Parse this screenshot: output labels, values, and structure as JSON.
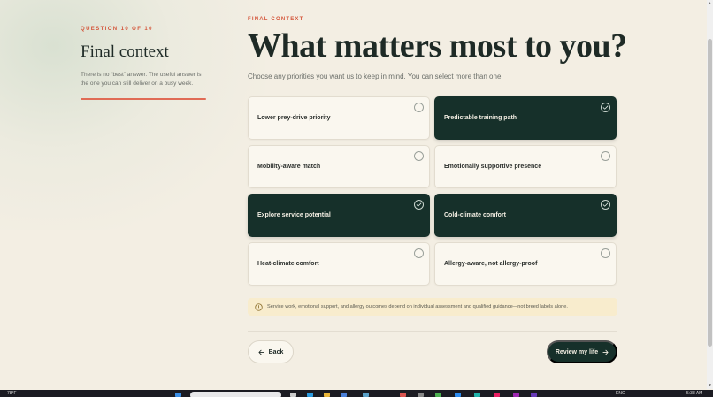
{
  "sidebar": {
    "eyebrow": "QUESTION 10 OF 10",
    "title": "Final context",
    "description": "There is no “best” answer. The useful answer is the one you can still deliver on a busy week.",
    "progress": 1.0
  },
  "main": {
    "eyebrow": "FINAL CONTEXT",
    "headline": "What matters most to you?",
    "subtitle": "Choose any priorities you want us to keep in mind. You can select more than one.",
    "options": [
      {
        "label": "Lower prey-drive priority",
        "selected": false
      },
      {
        "label": "Predictable training path",
        "selected": true
      },
      {
        "label": "Mobility-aware match",
        "selected": false
      },
      {
        "label": "Emotionally supportive presence",
        "selected": false
      },
      {
        "label": "Explore service potential",
        "selected": true
      },
      {
        "label": "Cold-climate comfort",
        "selected": true
      },
      {
        "label": "Heat-climate comfort",
        "selected": false
      },
      {
        "label": "Allergy-aware, not allergy-proof",
        "selected": false
      }
    ],
    "notice": "Service work, emotional support, and allergy outcomes depend on individual assessment and qualified guidance—not breed labels alone.",
    "back_label": "Back",
    "next_label": "Review my life"
  },
  "taskbar": {
    "weather": "78°F",
    "tray": "ENG",
    "clock": "5:38 AM"
  },
  "colors": {
    "background": "#f3eee3",
    "accent": "#d4553a",
    "selected_card": "#16302a",
    "notice_bg": "#f8eccd"
  }
}
